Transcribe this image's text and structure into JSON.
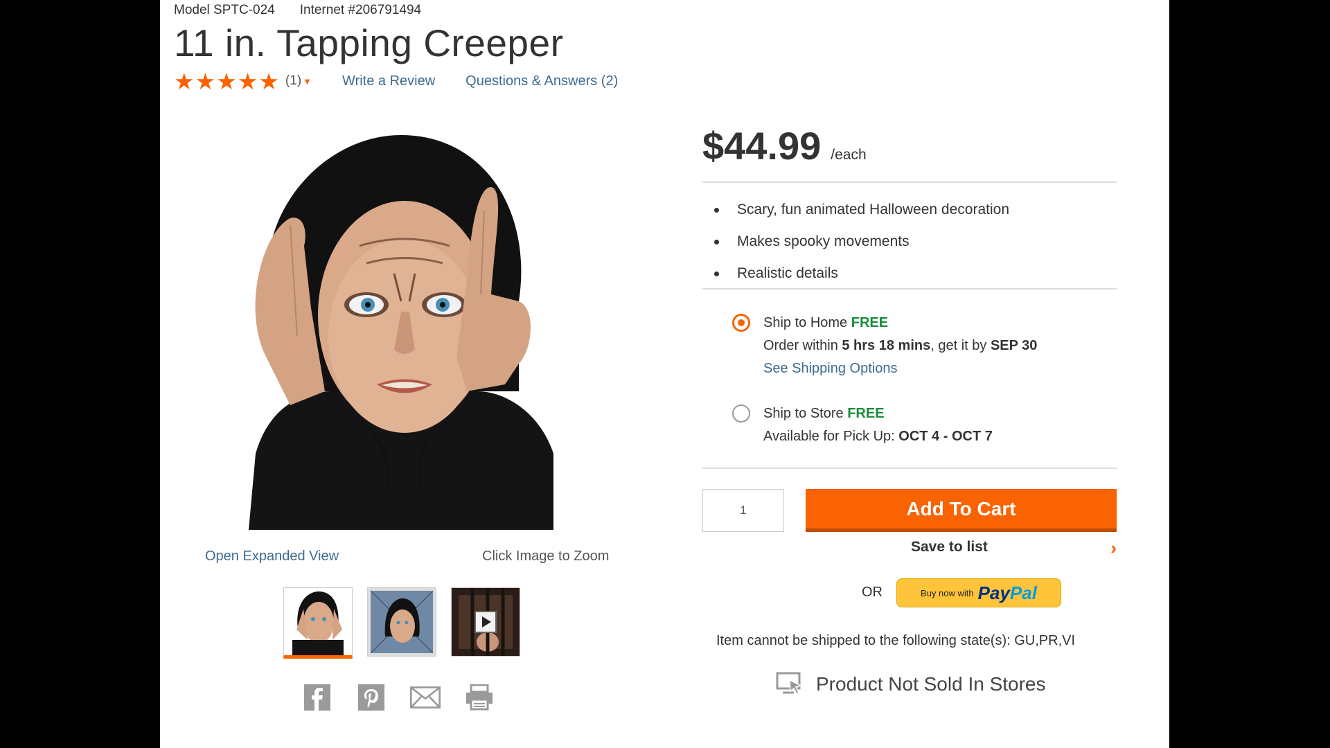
{
  "product": {
    "model": "Model SPTC-024",
    "internet": "Internet #206791494",
    "title": "11 in. Tapping Creeper",
    "stars": "★★★★★",
    "rating_count": "(1)",
    "write_review": "Write a Review",
    "qa": "Questions & Answers (2)"
  },
  "gallery": {
    "open_expanded": "Open Expanded View",
    "zoom_hint": "Click Image to Zoom",
    "thumbnails": [
      "thumbnail-front",
      "thumbnail-window",
      "thumbnail-video"
    ]
  },
  "pricing": {
    "price": "$44.99",
    "unit": "/each"
  },
  "bullets": [
    "Scary, fun animated Halloween decoration",
    "Makes spooky movements",
    "Realistic details"
  ],
  "shipping": {
    "home": {
      "label": "Ship to Home ",
      "free": "FREE",
      "order_prefix": "Order within ",
      "order_time": "5 hrs 18 mins",
      "order_mid": ", get it by ",
      "order_date": "SEP 30",
      "options_link": "See Shipping Options",
      "selected": true
    },
    "store": {
      "label": "Ship to Store ",
      "free": "FREE",
      "pickup_prefix": "Available for Pick Up: ",
      "pickup_dates": "OCT 4 - OCT 7",
      "selected": false
    }
  },
  "cart": {
    "quantity": "1",
    "add_to_cart": "Add To Cart",
    "save_to_list": "Save to list",
    "or": "OR",
    "paypal_buy": "Buy now with",
    "paypal_pay": "Pay",
    "paypal_pal": "Pal"
  },
  "notices": {
    "states": "Item cannot be shipped to the following state(s): GU,PR,VI",
    "not_sold": "Product Not Sold In Stores"
  },
  "colors": {
    "accent": "#f96302",
    "link": "#3d6b8f",
    "free": "#1b8c3d"
  }
}
